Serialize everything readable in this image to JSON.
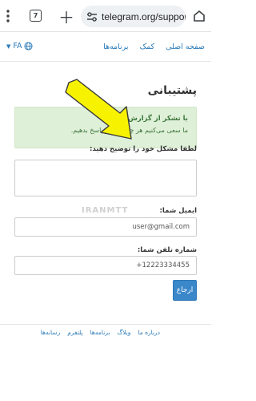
{
  "browser": {
    "tab_count": "7",
    "url": "telegram.org/support"
  },
  "nav": {
    "language": "FA",
    "links": [
      "صفحه اصلی",
      "کمک",
      "برنامه‌ها"
    ]
  },
  "page": {
    "title": "پشتیبانی",
    "notice_line1": "با تشکر از گزارش شما!",
    "notice_line2": "ما سعی می‌کنیم هر چه سریع‌تر پاسخ بدهیم."
  },
  "form": {
    "problem_label": "لطفا مشکل خود را توضیح دهید:",
    "email_label": "ایمیل شما:",
    "email_value": "user@gmail.com",
    "phone_label": "شماره تلفن شما:",
    "phone_value": "+12223334455",
    "submit_label": "ارجاع"
  },
  "watermark": "IRANMTT",
  "footer": {
    "links": [
      "درباره ما",
      "وبلاگ",
      "برنامه‌ها",
      "پلتفرم",
      "رسانه‌ها"
    ]
  },
  "colors": {
    "link": "#2a7ab8",
    "notice_bg": "#dff0d8",
    "notice_text": "#3c763d",
    "button": "#3a87c9",
    "arrow": "#f7f300"
  }
}
